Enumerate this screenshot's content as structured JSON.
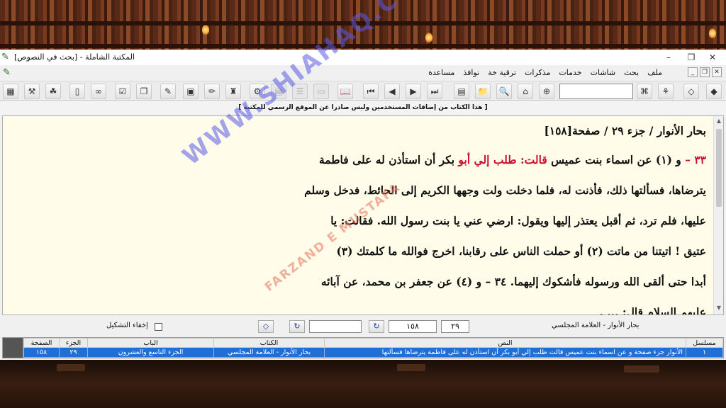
{
  "window": {
    "title": "المكتبة الشاملة - [بحث في النصوص]"
  },
  "menu": {
    "items": [
      "ملف",
      "بحث",
      "شاشات",
      "خدمات",
      "مذكرات",
      "ترقية خة",
      "نوافذ",
      "مساعدة"
    ]
  },
  "notice": "[ هذا الكتاب من إضافات المستخدمين وليس صادرا عن الموقع الرسمي للمكتبة ]",
  "content": {
    "heading": "بحار الأنوار / جزء ٢٩ / صفحة[١٥٨]",
    "line1_prefix": "٣٣ – ",
    "line1_mid": "و (١) عن اسماء بنت عميس ",
    "line1_red": "قالت: طلب إلي أبو",
    "line1_suffix": " بكر أن استأذن له على فاطمة",
    "line2": "يترضاها، فسألتها ذلك، فأذنت له، فلما دخلت ولت وجهها الكريم إلى الحائط، فدخل وسلم",
    "line3": "عليها، فلم ترد، ثم أقبل يعتذر إليها ويقول: ارضي عني يا بنت رسول الله. فقالت: يا",
    "line4": "عتيق ! اتيتنا من ماتت (٢) أو حملت الناس على رقابنا، اخرج فوالله ما كلمتك (٣)",
    "line5": "أبدا حتى ألقى الله ورسوله فأشكوك إليهما. ٣٤ – و (٤) عن جعفر بن محمد، عن آبائه",
    "line6": "عليهم السلام قال: ... ."
  },
  "watermark": {
    "main": "WWW.SHIAHAQ.COM",
    "sub": "FARZAND E MUSTAFA"
  },
  "navigation": {
    "book_label": "بحار الأنوار - العلامة المجلسي",
    "part_value": "٢٩",
    "page_value": "١٥٨",
    "hide_diacritics_label": "إخفاء التشكيل",
    "refresh_icon": "↻"
  },
  "results": {
    "columns": [
      "مسلسل",
      "النص",
      "الكتاب",
      "الباب",
      "الجزء",
      "الصفحة"
    ],
    "rows": [
      {
        "serial": "١",
        "text": "الأنوار جزء صفحة و عن اسماء بنت عميس قالت طلب إلي أبو بكر أن استأذن له على فاطمة يترضاها فسألتها",
        "book": "بحار الأنوار - العلامة المجلسي",
        "chapter": "الجزء التاسع والعشرون",
        "part": "٢٩",
        "page": "١٥٨"
      }
    ]
  }
}
